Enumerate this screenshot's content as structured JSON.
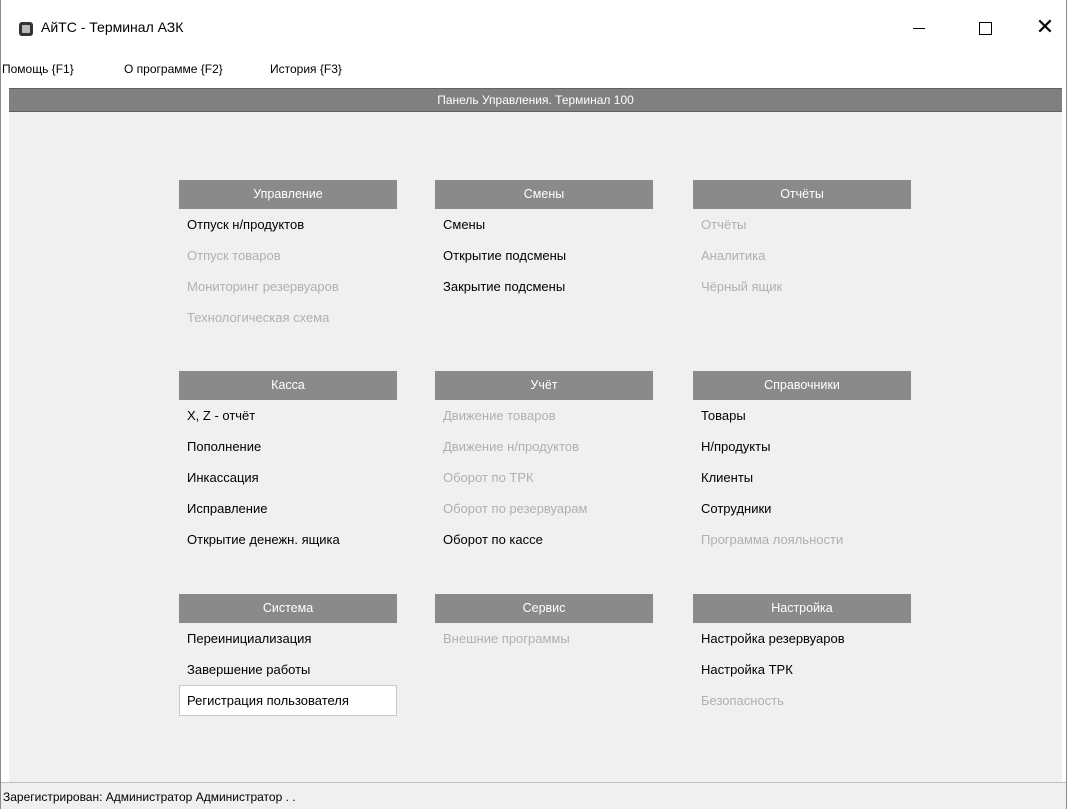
{
  "window": {
    "title": "АйТС - Терминал АЗК"
  },
  "menu": {
    "items": [
      {
        "label": "Помощь {F1}"
      },
      {
        "label": "О программе {F2}"
      },
      {
        "label": "История {F3}"
      }
    ]
  },
  "panel": {
    "title": "Панель Управления. Терминал 100"
  },
  "sections": {
    "upravlenie": {
      "title": "Управление",
      "items": [
        {
          "label": "Отпуск н/продуктов",
          "enabled": true
        },
        {
          "label": "Отпуск товаров",
          "enabled": false
        },
        {
          "label": "Мониторинг резервуаров",
          "enabled": false
        },
        {
          "label": "Технологическая схема",
          "enabled": false
        }
      ]
    },
    "smeny": {
      "title": "Смены",
      "items": [
        {
          "label": "Смены",
          "enabled": true
        },
        {
          "label": "Открытие подсмены",
          "enabled": true
        },
        {
          "label": "Закрытие подсмены",
          "enabled": true
        }
      ]
    },
    "otchety": {
      "title": "Отчёты",
      "items": [
        {
          "label": "Отчёты",
          "enabled": false
        },
        {
          "label": "Аналитика",
          "enabled": false
        },
        {
          "label": "Чёрный ящик",
          "enabled": false
        }
      ]
    },
    "kassa": {
      "title": "Касса",
      "items": [
        {
          "label": "X, Z - отчёт",
          "enabled": true
        },
        {
          "label": "Пополнение",
          "enabled": true
        },
        {
          "label": "Инкассация",
          "enabled": true
        },
        {
          "label": "Исправление",
          "enabled": true
        },
        {
          "label": "Открытие денежн. ящика",
          "enabled": true
        }
      ]
    },
    "uchet": {
      "title": "Учёт",
      "items": [
        {
          "label": "Движение товаров",
          "enabled": false
        },
        {
          "label": "Движение н/продуктов",
          "enabled": false
        },
        {
          "label": "Оборот по ТРК",
          "enabled": false
        },
        {
          "label": "Оборот по резервуарам",
          "enabled": false
        },
        {
          "label": "Оборот по кассе",
          "enabled": true
        }
      ]
    },
    "spravochniki": {
      "title": "Справочники",
      "items": [
        {
          "label": "Товары",
          "enabled": true
        },
        {
          "label": "Н/продукты",
          "enabled": true
        },
        {
          "label": "Клиенты",
          "enabled": true
        },
        {
          "label": "Сотрудники",
          "enabled": true
        },
        {
          "label": "Программа лояльности",
          "enabled": false
        }
      ]
    },
    "sistema": {
      "title": "Система",
      "items": [
        {
          "label": "Переинициализация",
          "enabled": true
        },
        {
          "label": "Завершение работы",
          "enabled": true
        },
        {
          "label": "Регистрация пользователя",
          "enabled": true,
          "selected": true
        }
      ]
    },
    "servis": {
      "title": "Сервис",
      "items": [
        {
          "label": "Внешние программы",
          "enabled": false
        }
      ]
    },
    "nastroyka": {
      "title": "Настройка",
      "items": [
        {
          "label": "Настройка резервуаров",
          "enabled": true
        },
        {
          "label": "Настройка ТРК",
          "enabled": true
        },
        {
          "label": "Безопасность",
          "enabled": false
        }
      ]
    }
  },
  "status": {
    "text": "Зарегистрирован: Администратор Администратор  . ."
  },
  "colors": {
    "section_header_bg": "#8a8a8a",
    "panel_header_bg": "#808080",
    "disabled_text": "#b0b0b0"
  }
}
